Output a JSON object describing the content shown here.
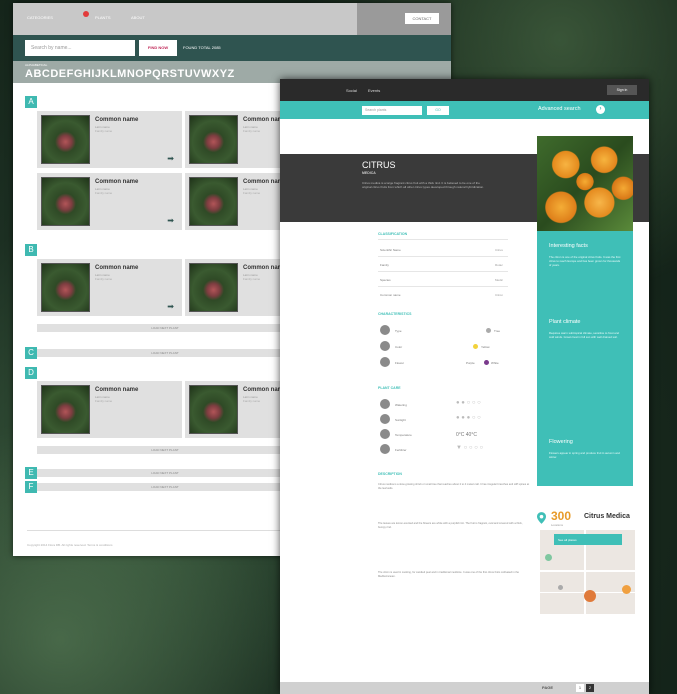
{
  "left_window": {
    "nav": [
      "CATEGORIES",
      "PLANTS",
      "ABOUT"
    ],
    "top_button": "CONTACT",
    "search_placeholder": "Search by name...",
    "find_button": "FIND NOW",
    "total_label": "FOUND TOTAL 2085",
    "alphabet_label": "ALPHABETICAL",
    "alphabet": "ABCDEFGHIJKLMNOPQRSTUVWXYZ",
    "sections": [
      "A",
      "B",
      "C",
      "D",
      "E",
      "F"
    ],
    "card": {
      "common_name": "Common name",
      "latin_name": "Latin name",
      "family": "Family name"
    },
    "load_more": "LOAD NEXT PLANT",
    "footer": "Copyright 2014 Flora DB. All rights reserved. Terms & conditions"
  },
  "right_window": {
    "nav": [
      "Social",
      "Events"
    ],
    "sign_in": "Sign in",
    "search_placeholder": "Search plants",
    "search_button": "GO",
    "advanced_search": "Advanced search",
    "plant_title": "CITRUS",
    "plant_subtitle": "MEDICA",
    "plant_desc": "Citrus medica is a large fragrant citrus fruit with a thick rind. It is believed to be one of the original citrus fruits from which all other citrus types developed through natural hybridization.",
    "classification_title": "CLASSIFICATION",
    "classification": [
      {
        "label": "Scientific Name",
        "value": "Citrus"
      },
      {
        "label": "Family",
        "value": "Rutac"
      },
      {
        "label": "Species",
        "value": "Medic"
      },
      {
        "label": "Common name",
        "value": "Citron"
      }
    ],
    "characteristics_title": "CHARACTERISTICS",
    "characteristics": [
      {
        "label": "Type",
        "opt1": "Tree"
      },
      {
        "label": "Color",
        "opt1": "Yellow"
      },
      {
        "label": "Flower",
        "opt1": "Purple",
        "opt2": "White"
      }
    ],
    "care_title": "PLANT CARE",
    "care": [
      {
        "label": "Watering"
      },
      {
        "label": "Sunlight"
      },
      {
        "label": "Temperature",
        "value": "0°C  40°C"
      },
      {
        "label": "Fertilizer"
      }
    ],
    "description_title": "DESCRIPTION",
    "desc_paragraphs": [
      "Citrus medica is a slow-growing shrub or small tree that reaches about 2 to 4 meters tall. It has irregular branches and stiff spines at the leaf axils.",
      "The leaves are lemon-scented and the flowers are white with a purplish tint. The fruit is fragrant, oval and covered with a thick, bumpy rind.",
      "The citron is used in cooking, for candied peel and in traditional medicine. It was one of the first citrus fruits cultivated in the Mediterranean."
    ],
    "sidebar": [
      {
        "title": "Interesting facts",
        "text": "The citron is one of the original citrus fruits. It was the first citrus to reach Europe and has been grown for thousands of years."
      },
      {
        "title": "Plant climate",
        "text": "Requires warm subtropical climate, sensitive to frost and cold winds. Grows best in full sun with well drained soil."
      },
      {
        "title": "Flowering",
        "text": "Flowers appear in spring and produce fruit in autumn and winter."
      }
    ],
    "map": {
      "count": "300",
      "count_label": "Locations",
      "title": "Citrus Medica",
      "bar_label": "See all places"
    },
    "footer": {
      "label": "PAGE",
      "page1": "1",
      "page2": "2"
    }
  }
}
